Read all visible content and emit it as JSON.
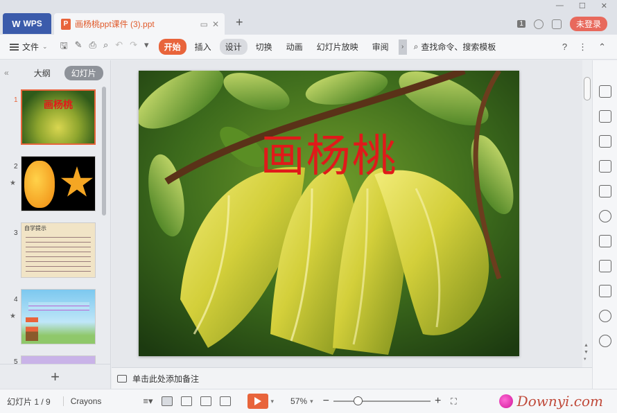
{
  "titlebar": {
    "wps_label": "WPS",
    "doc_title": "画杨桃ppt课件 (3).ppt",
    "new_tab": "+",
    "badge": "1",
    "login": "未登录"
  },
  "ribbon": {
    "file": "文件",
    "tabs": [
      "开始",
      "插入",
      "设计",
      "切换",
      "动画",
      "幻灯片放映",
      "审阅"
    ],
    "active_tab": "开始",
    "selected_tab": "设计",
    "search": "查找命令、搜索模板",
    "help": "?"
  },
  "left_panel": {
    "tab_outline": "大纲",
    "tab_slides": "幻灯片",
    "slides": [
      {
        "num": "1",
        "title": "画杨桃"
      },
      {
        "num": "2",
        "star": "★"
      },
      {
        "num": "3",
        "heading": "自学提示"
      },
      {
        "num": "4",
        "star": "★"
      },
      {
        "num": "5"
      }
    ]
  },
  "slide": {
    "title": "画杨桃"
  },
  "notes": {
    "placeholder": "单击此处添加备注"
  },
  "status": {
    "slide_counter": "幻灯片 1 / 9",
    "theme": "Crayons",
    "zoom": "57%",
    "zoom_level": 0.57,
    "watermark": "Downyi.com"
  },
  "colors": {
    "accent": "#e8643b",
    "wps_blue": "#3b5bab",
    "title_red": "#e01a1a"
  }
}
